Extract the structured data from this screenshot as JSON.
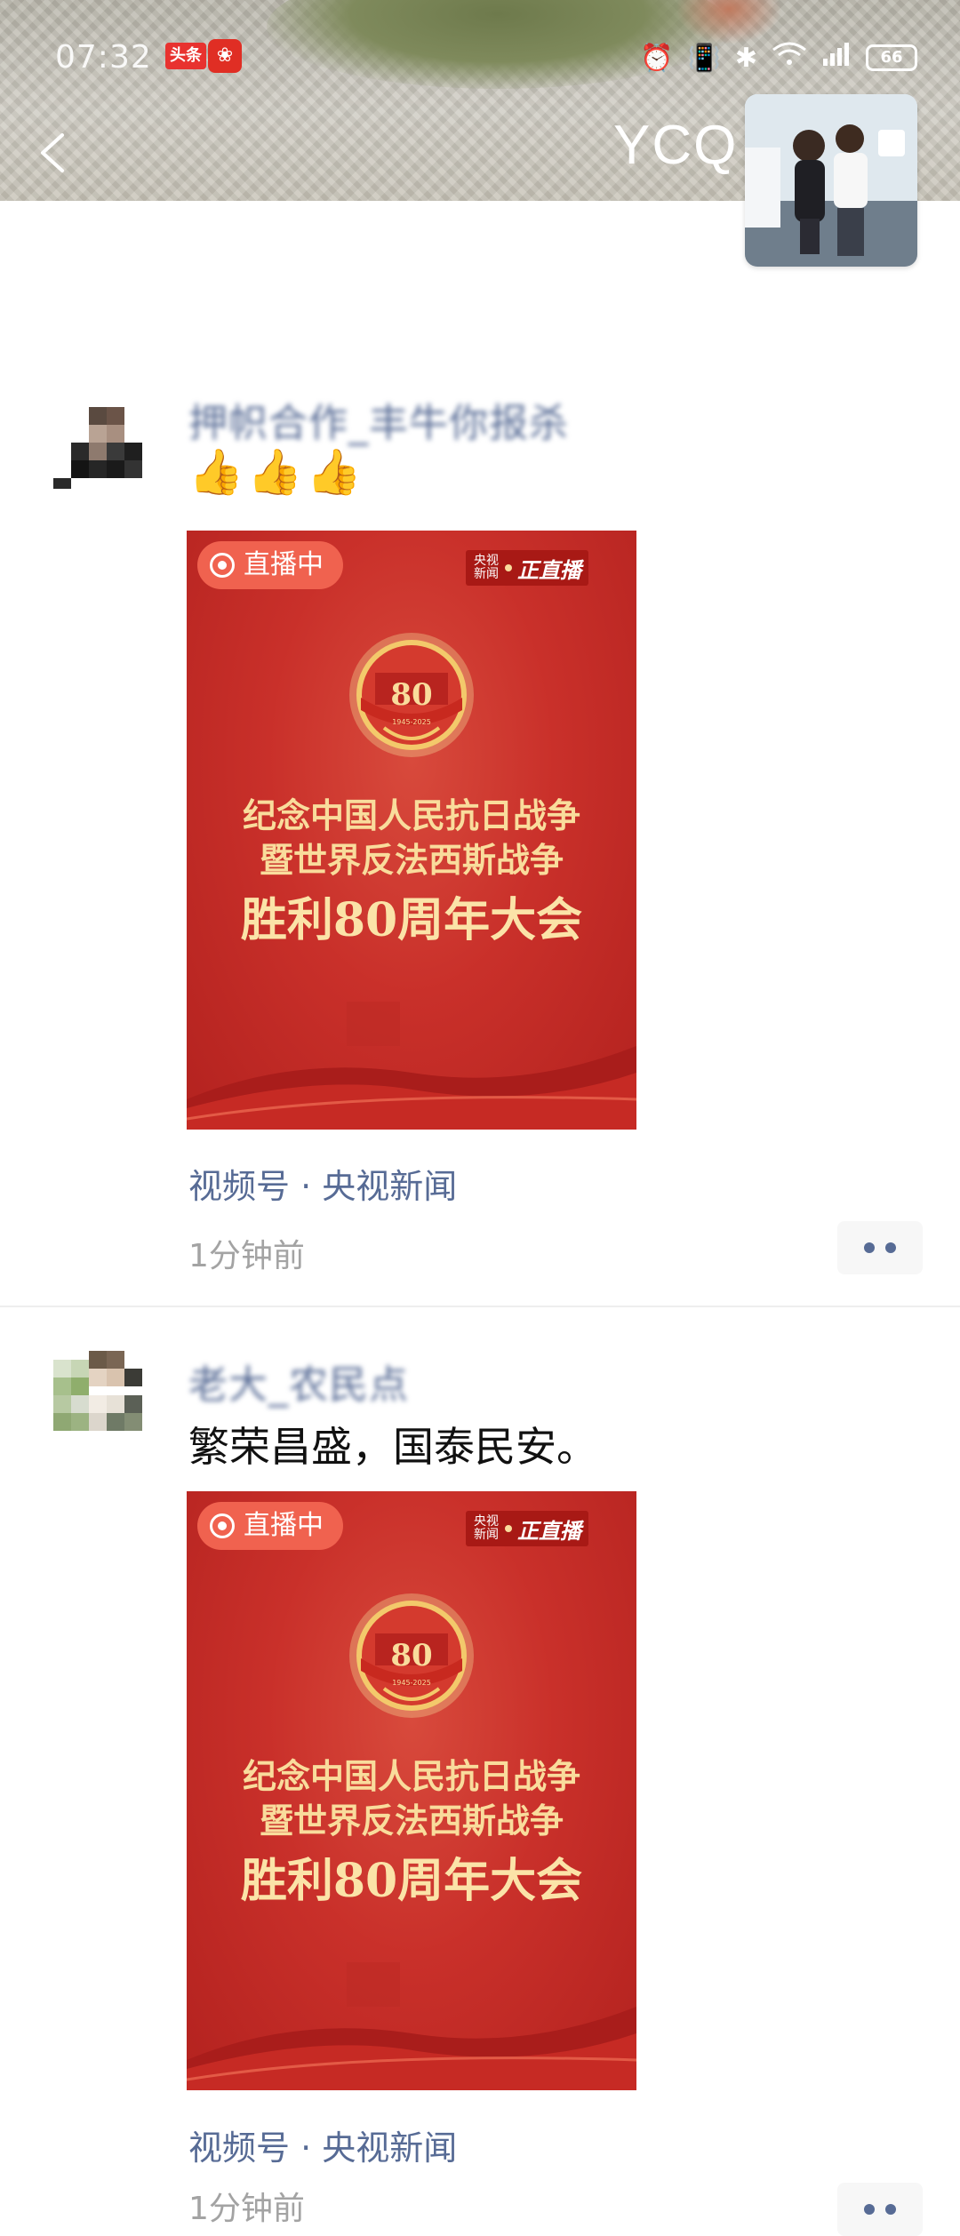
{
  "status_bar": {
    "time": "07:32",
    "notification_app": "头条",
    "battery": "66"
  },
  "header": {
    "owner_name": "YCQ"
  },
  "posts": [
    {
      "nickname": "押帜合作_丰牛你报杀",
      "content": "👍👍👍",
      "video": {
        "live_label": "直播中",
        "channel_small": "央视新闻",
        "channel_big": "正直播",
        "emblem_number": "80",
        "emblem_years": "1945-2025",
        "title_line1": "纪念中国人民抗日战争",
        "title_line2": "暨世界反法西斯战争",
        "title_line3": "胜利80周年大会"
      },
      "source": "视频号 · 央视新闻",
      "time_ago": "1分钟前"
    },
    {
      "nickname": "老大_农民点",
      "content": "繁荣昌盛，国泰民安。",
      "video": {
        "live_label": "直播中",
        "channel_small": "央视新闻",
        "channel_big": "正直播",
        "emblem_number": "80",
        "emblem_years": "1945-2025",
        "title_line1": "纪念中国人民抗日战争",
        "title_line2": "暨世界反法西斯战争",
        "title_line3": "胜利80周年大会"
      },
      "source": "视频号 · 央视新闻",
      "time_ago": "1分钟前"
    }
  ],
  "colors": {
    "link": "#576b95",
    "poster_red": "#c9302a",
    "poster_gold": "#f9dc9c",
    "live_badge": "#f0624f"
  }
}
